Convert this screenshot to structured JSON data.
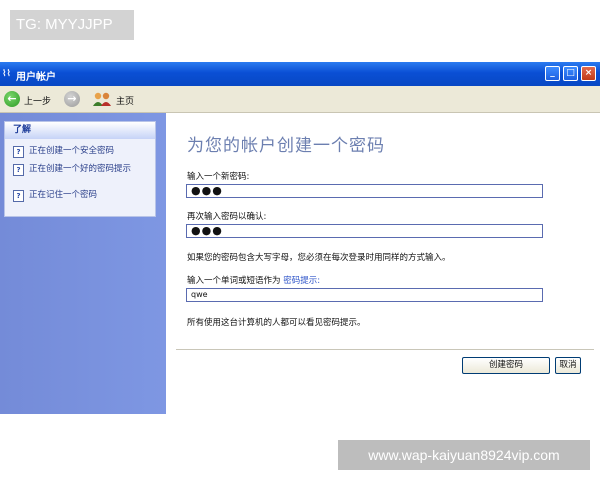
{
  "overlay_tag": "TG: MYYJJPP",
  "window": {
    "app_icon": "⌇⌇",
    "title": "用户帐户",
    "controls": {
      "minimize": "_",
      "maximize": "□",
      "close": "×"
    }
  },
  "toolbar": {
    "back_label": "上一步",
    "back_glyph": "←",
    "forward_glyph": "→",
    "home_label": "主页",
    "icons": [
      "back-arrow-icon",
      "forward-arrow-icon",
      "users-home-icon"
    ]
  },
  "sidebar": {
    "title": "了解",
    "items": [
      {
        "label": "正在创建一个安全密码",
        "icon": "help-icon"
      },
      {
        "label": "正在创建一个好的密码提示",
        "icon": "help-icon"
      },
      {
        "label": "正在记住一个密码",
        "icon": "help-icon"
      }
    ],
    "help_glyph": "?"
  },
  "main": {
    "heading": "为您的帐户创建一个密码",
    "new_password_label": "输入一个新密码:",
    "new_password_value": "●●●",
    "confirm_password_label": "再次输入密码以确认:",
    "confirm_password_value": "●●●",
    "caps_note": "如果您的密码包含大写字母，您必须在每次登录时用同样的方式输入。",
    "hint_label_prefix": "输入一个单词或短语作为",
    "hint_label_link": "密码提示:",
    "hint_value": "qwe",
    "hint_note": "所有使用这台计算机的人都可以看见密码提示。",
    "create_button": "创建密码",
    "cancel_button": "取消"
  },
  "watermark": "www.wap-kaiyuan8924vip.com",
  "colors": {
    "titlebar": "#0a4fd4",
    "sidebar": "#7e97e3",
    "heading": "#6c7fb0",
    "link": "#2f55c9"
  }
}
